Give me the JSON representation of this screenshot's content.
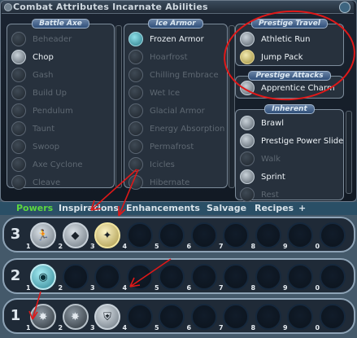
{
  "window": {
    "title": "Combat Attributes  Incarnate Abilities"
  },
  "panels": {
    "battle_axe": {
      "title": "Battle Axe",
      "items": [
        {
          "label": "Beheader",
          "active": false
        },
        {
          "label": "Chop",
          "active": true
        },
        {
          "label": "Gash",
          "active": false
        },
        {
          "label": "Build Up",
          "active": false
        },
        {
          "label": "Pendulum",
          "active": false
        },
        {
          "label": "Taunt",
          "active": false
        },
        {
          "label": "Swoop",
          "active": false
        },
        {
          "label": "Axe Cyclone",
          "active": false
        },
        {
          "label": "Cleave",
          "active": false
        }
      ]
    },
    "ice_armor": {
      "title": "Ice Armor",
      "items": [
        {
          "label": "Frozen Armor",
          "active": true
        },
        {
          "label": "Hoarfrost",
          "active": false
        },
        {
          "label": "Chilling Embrace",
          "active": false
        },
        {
          "label": "Wet Ice",
          "active": false
        },
        {
          "label": "Glacial Armor",
          "active": false
        },
        {
          "label": "Energy Absorption",
          "active": false
        },
        {
          "label": "Permafrost",
          "active": false
        },
        {
          "label": "Icicles",
          "active": false
        },
        {
          "label": "Hibernate",
          "active": false
        }
      ]
    },
    "prestige_travel": {
      "title": "Prestige Travel",
      "items": [
        {
          "label": "Athletic Run",
          "active": true
        },
        {
          "label": "Jump Pack",
          "active": true
        }
      ]
    },
    "prestige_attacks": {
      "title": "Prestige Attacks",
      "items": [
        {
          "label": "Apprentice Charm",
          "active": true
        }
      ]
    },
    "inherent": {
      "title": "Inherent",
      "items": [
        {
          "label": "Brawl",
          "active": true
        },
        {
          "label": "Prestige Power Slide",
          "active": true
        },
        {
          "label": "Walk",
          "active": false
        },
        {
          "label": "Sprint",
          "active": true
        },
        {
          "label": "Rest",
          "active": false
        }
      ]
    }
  },
  "tabs": [
    {
      "label": "Powers",
      "selected": true
    },
    {
      "label": "Inspirations",
      "selected": false
    },
    {
      "label": "Enhancements",
      "selected": false
    },
    {
      "label": "Salvage",
      "selected": false
    },
    {
      "label": "Recipes",
      "selected": false
    },
    {
      "label": "+",
      "selected": false
    }
  ],
  "trays": [
    {
      "number": "3",
      "slots": [
        {
          "key": "1",
          "filled": true,
          "icon": "running-figure-icon",
          "glyph": "🏃"
        },
        {
          "key": "2",
          "filled": true,
          "icon": "jump-pack-icon",
          "glyph": "◆"
        },
        {
          "key": "3",
          "filled": true,
          "icon": "charm-icon",
          "glyph": "✦"
        },
        {
          "key": "4",
          "filled": false
        },
        {
          "key": "5",
          "filled": false
        },
        {
          "key": "6",
          "filled": false
        },
        {
          "key": "7",
          "filled": false
        },
        {
          "key": "8",
          "filled": false
        },
        {
          "key": "9",
          "filled": false
        },
        {
          "key": "0",
          "filled": false
        }
      ]
    },
    {
      "number": "2",
      "slots": [
        {
          "key": "1",
          "filled": true,
          "icon": "frozen-armor-icon",
          "glyph": "◉"
        },
        {
          "key": "2",
          "filled": false
        },
        {
          "key": "3",
          "filled": false
        },
        {
          "key": "4",
          "filled": false
        },
        {
          "key": "5",
          "filled": false
        },
        {
          "key": "6",
          "filled": false
        },
        {
          "key": "7",
          "filled": false
        },
        {
          "key": "8",
          "filled": false
        },
        {
          "key": "9",
          "filled": false
        },
        {
          "key": "0",
          "filled": false
        }
      ]
    },
    {
      "number": "1",
      "slots": [
        {
          "key": "1",
          "filled": true,
          "icon": "brawl-icon",
          "glyph": "✸"
        },
        {
          "key": "2",
          "filled": true,
          "icon": "chop-icon",
          "glyph": "✸"
        },
        {
          "key": "3",
          "filled": true,
          "icon": "shield-icon",
          "glyph": "⛨"
        },
        {
          "key": "4",
          "filled": false
        },
        {
          "key": "5",
          "filled": false
        },
        {
          "key": "6",
          "filled": false
        },
        {
          "key": "7",
          "filled": false
        },
        {
          "key": "8",
          "filled": false
        },
        {
          "key": "9",
          "filled": false
        },
        {
          "key": "0",
          "filled": false
        }
      ]
    }
  ],
  "colors": {
    "tab_selected": "#5cd63f",
    "tab_normal": "#d8e3ea",
    "annotation_red": "#e01818"
  }
}
